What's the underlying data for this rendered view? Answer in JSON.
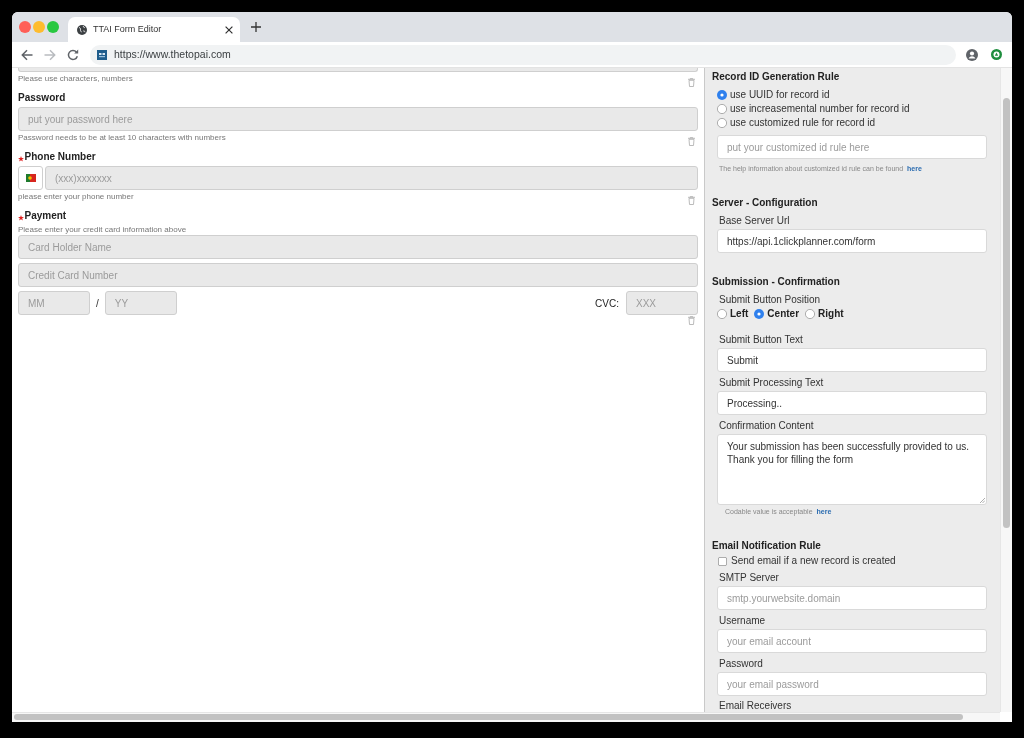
{
  "browser": {
    "tabs": [
      {
        "title": "TTAI Form Editor",
        "selected": true
      }
    ],
    "forward_disabled": true,
    "address": "https://www.thetopai.com"
  },
  "form": {
    "fields": [
      {
        "kind": "partial",
        "hint": "Please use characters, numbers"
      },
      {
        "kind": "text",
        "label": "Password",
        "required": false,
        "placeholder": "put your password here",
        "hint": "Password needs to be at least 10 characters with numbers"
      },
      {
        "kind": "phone",
        "label": "Phone Number",
        "required": true,
        "placeholder": "(xxx)xxxxxxx",
        "hint": "please enter your phone number"
      },
      {
        "kind": "payment",
        "label": "Payment",
        "required": true,
        "hint": "Please enter your credit card information above",
        "inputs": [
          {
            "placeholder": "Card Holder Name"
          },
          {
            "placeholder": "Credit Card Number"
          }
        ],
        "month_placeholder": "MM",
        "separator": "/",
        "year_placeholder": "YY",
        "cvc_label": "CVC:",
        "cvc_placeholder": "XXX"
      }
    ]
  },
  "settings": {
    "sections": [
      {
        "title": "Record ID Generation Rule",
        "items": [
          {
            "kind": "radio_list",
            "options": [
              {
                "label": "use UUID for record id",
                "selected": true
              },
              {
                "label": "use increasemental number for record id",
                "selected": false
              },
              {
                "label": "use customized rule for record id",
                "selected": false
              }
            ]
          },
          {
            "kind": "input",
            "placeholder": "put your customized id rule here"
          },
          {
            "kind": "note",
            "text": "The help information about customized id rule can be found",
            "link": "here"
          }
        ]
      },
      {
        "title": "Server - Configuration",
        "items": [
          {
            "kind": "input",
            "label": "Base Server Url",
            "value": "https://api.1clickplanner.com/form"
          }
        ]
      },
      {
        "title": "Submission - Confirmation",
        "items": [
          {
            "kind": "radio_row",
            "label": "Submit Button Position",
            "options": [
              {
                "label": "Left",
                "selected": false
              },
              {
                "label": "Center",
                "selected": true
              },
              {
                "label": "Right",
                "selected": false
              }
            ]
          },
          {
            "kind": "input",
            "label": "Submit Button Text",
            "value": "Submit"
          },
          {
            "kind": "input",
            "label": "Submit Processing Text",
            "value": "Processing.."
          },
          {
            "kind": "textarea",
            "label": "Confirmation Content",
            "value": "Your submission has been successfully provided to us.\nThank you for filling the form"
          },
          {
            "kind": "note",
            "text": "Codable value is acceptable",
            "link": "here"
          }
        ]
      },
      {
        "title": "Email Notification Rule",
        "items": [
          {
            "kind": "checkbox",
            "label": "Send email if a new record is created",
            "checked": false
          },
          {
            "kind": "input",
            "label": "SMTP Server",
            "placeholder": "smtp.yourwebsite.domain"
          },
          {
            "kind": "input",
            "label": "Username",
            "placeholder": "your email account"
          },
          {
            "kind": "input",
            "label": "Password",
            "placeholder": "your email password"
          },
          {
            "kind": "label",
            "label": "Email Receivers"
          }
        ]
      }
    ]
  }
}
